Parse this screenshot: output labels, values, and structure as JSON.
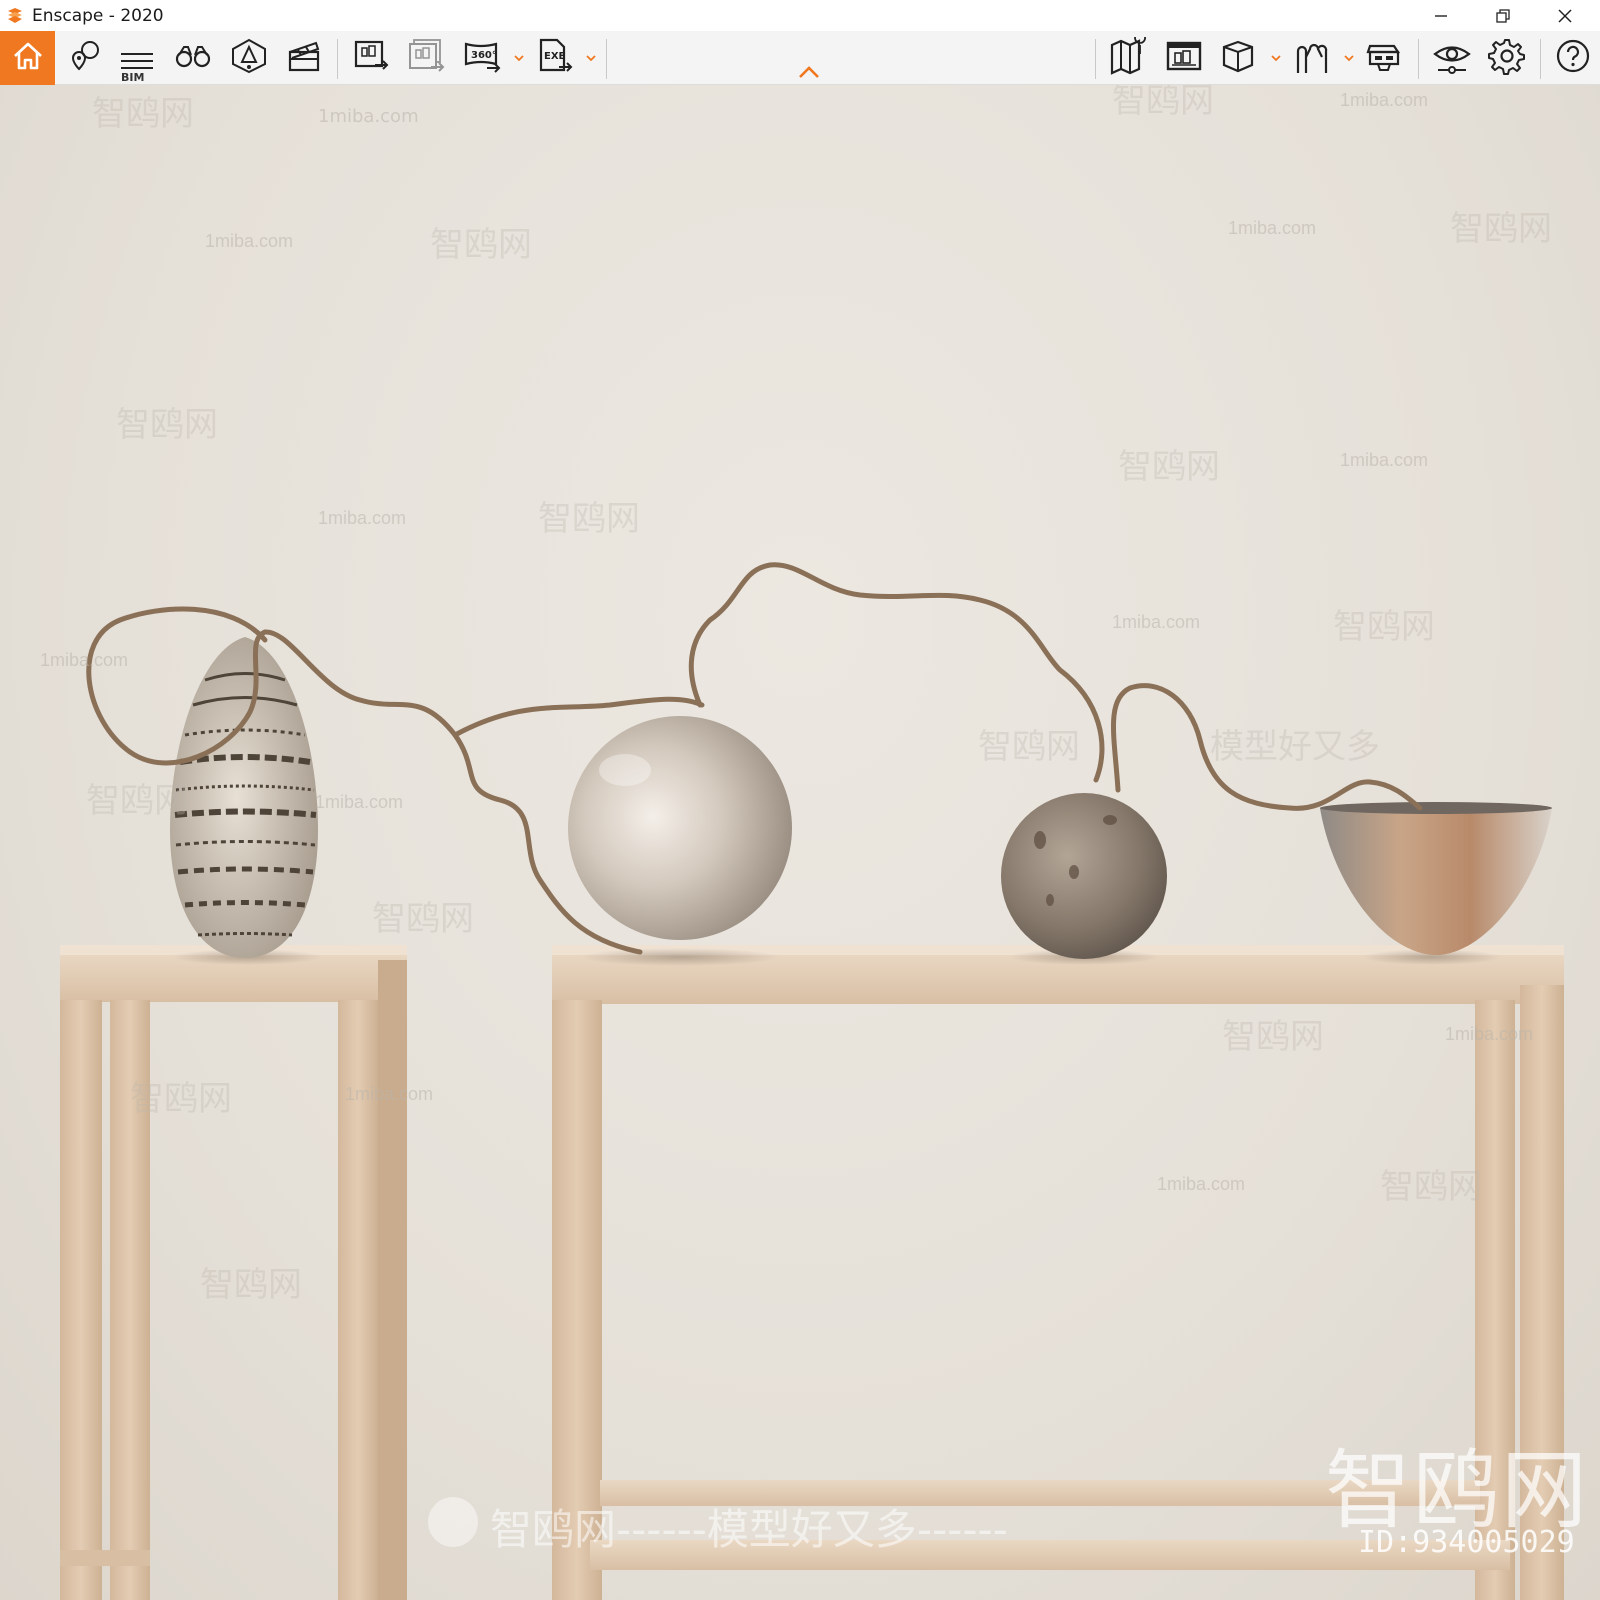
{
  "window": {
    "title": "Enscape - 2020",
    "min_glyph": "—",
    "restore_glyph": "❐",
    "close_glyph": "✕"
  },
  "toolbar": {
    "accent_color": "#f07820",
    "bim_label": "BIM",
    "left_tools": [
      {
        "icon": "home-icon"
      },
      {
        "icon": "location-pin-icon"
      },
      {
        "icon": "bim-list-icon"
      },
      {
        "icon": "binoculars-icon"
      },
      {
        "icon": "sun-position-icon"
      },
      {
        "icon": "clapperboard-icon"
      },
      {
        "icon": "render-image-icon"
      },
      {
        "icon": "batch-render-icon"
      },
      {
        "icon": "render-360-icon",
        "label": "360°",
        "has_dropdown": true
      },
      {
        "icon": "export-exe-icon",
        "label": "EXE",
        "has_dropdown": true
      }
    ],
    "right_tools": [
      {
        "icon": "map-icon"
      },
      {
        "icon": "asset-library-icon"
      },
      {
        "icon": "cube-view-icon",
        "has_dropdown": true
      },
      {
        "icon": "people-icon",
        "has_dropdown": true
      },
      {
        "icon": "vr-headset-icon"
      },
      {
        "icon": "eye-visual-settings-icon"
      },
      {
        "icon": "gear-icon"
      },
      {
        "icon": "help-icon"
      }
    ]
  },
  "watermarks": {
    "domain": "1miba.com",
    "brand": "智鸥网",
    "slogan": "模型好又多",
    "dashes": "------",
    "bottom_line": "智鸥网------模型好又多------",
    "id_text": "ID:934005029"
  }
}
